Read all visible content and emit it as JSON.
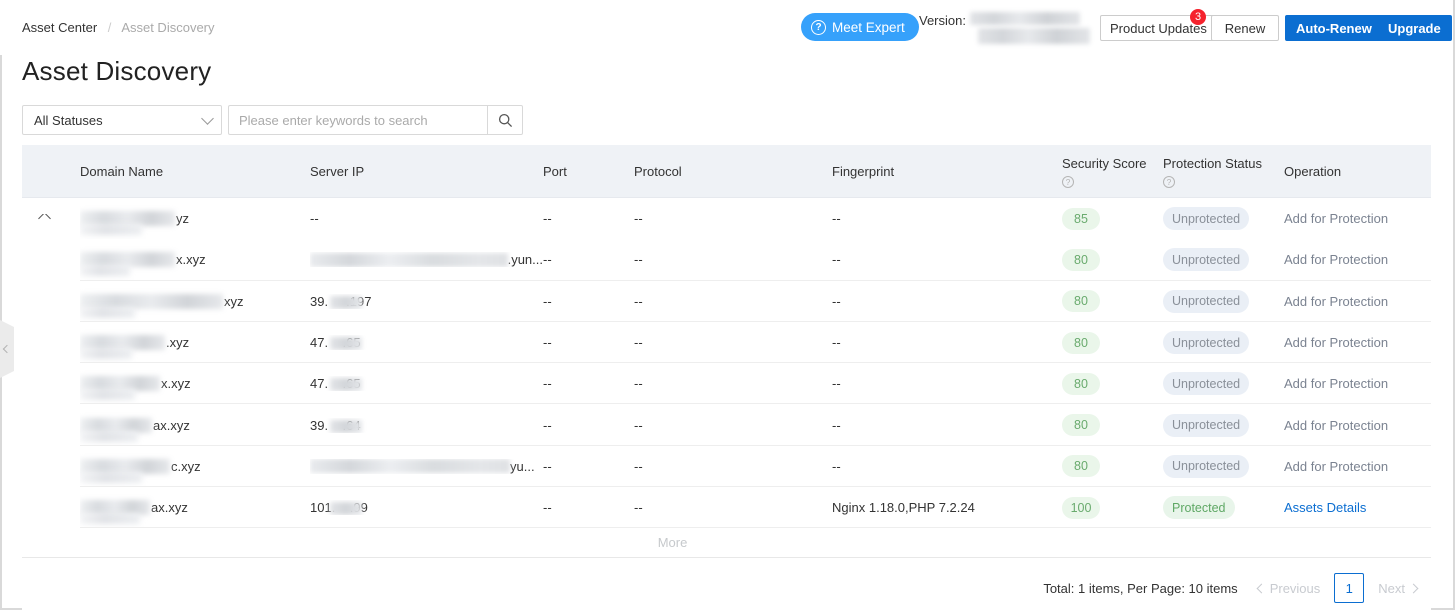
{
  "breadcrumb": {
    "parent": "Asset Center",
    "separator": "/",
    "current": "Asset Discovery"
  },
  "page_title": "Asset Discovery",
  "header": {
    "meet_expert": "Meet Expert",
    "version_label": "Version:",
    "product_updates": "Product Updates",
    "updates_badge": "3",
    "renew": "Renew",
    "auto_renew": "Auto-Renew",
    "upgrade": "Upgrade"
  },
  "filters": {
    "status_selected": "All Statuses",
    "status_options": [
      "All Statuses"
    ],
    "search_placeholder": "Please enter keywords to search",
    "search_value": ""
  },
  "table": {
    "columns": [
      {
        "label": "Domain Name",
        "help": false
      },
      {
        "label": "Server IP",
        "help": false
      },
      {
        "label": "Port",
        "help": false
      },
      {
        "label": "Protocol",
        "help": false
      },
      {
        "label": "Fingerprint",
        "help": false
      },
      {
        "label": "Security Score",
        "help": true
      },
      {
        "label": "Protection Status",
        "help": true
      },
      {
        "label": "Operation",
        "help": false
      }
    ],
    "help_glyph": "?",
    "rows": [
      {
        "domain_suffix": "yz",
        "domain_redact_w": 95,
        "domain_redact2_w": 62,
        "server_ip": "--",
        "ip_redact_w": 0,
        "port": "--",
        "protocol": "--",
        "fingerprint": "--",
        "security_score": "85",
        "protection_status": "Unprotected",
        "operation": "Add for Protection",
        "operation_style": "muted",
        "expandable": true
      },
      {
        "domain_suffix": "x.xyz",
        "domain_redact_w": 95,
        "domain_redact2_w": 50,
        "server_ip": ".yun...",
        "ip_redact_w": 205,
        "port": "--",
        "protocol": "--",
        "fingerprint": "--",
        "security_score": "80",
        "protection_status": "Unprotected",
        "operation": "Add for Protection",
        "operation_style": "muted",
        "expandable": false
      },
      {
        "domain_suffix": "xyz",
        "domain_redact_w": 143,
        "domain_redact2_w": 55,
        "server_ip": "39.     .197",
        "ip_redact_w": 0,
        "port": "--",
        "protocol": "--",
        "fingerprint": "--",
        "security_score": "80",
        "protection_status": "Unprotected",
        "operation": "Add for Protection",
        "operation_style": "muted",
        "expandable": false
      },
      {
        "domain_suffix": ".xyz",
        "domain_redact_w": 85,
        "domain_redact2_w": 52,
        "server_ip": "47.    .65",
        "ip_redact_w": 0,
        "port": "--",
        "protocol": "--",
        "fingerprint": "--",
        "security_score": "80",
        "protection_status": "Unprotected",
        "operation": "Add for Protection",
        "operation_style": "muted",
        "expandable": false
      },
      {
        "domain_suffix": "x.xyz",
        "domain_redact_w": 80,
        "domain_redact2_w": 55,
        "server_ip": "47.    .65",
        "ip_redact_w": 0,
        "port": "--",
        "protocol": "--",
        "fingerprint": "--",
        "security_score": "80",
        "protection_status": "Unprotected",
        "operation": "Add for Protection",
        "operation_style": "muted",
        "expandable": false
      },
      {
        "domain_suffix": "ax.xyz",
        "domain_redact_w": 72,
        "domain_redact2_w": 58,
        "server_ip": "39.    .64",
        "ip_redact_w": 0,
        "port": "--",
        "protocol": "--",
        "fingerprint": "--",
        "security_score": "80",
        "protection_status": "Unprotected",
        "operation": "Add for Protection",
        "operation_style": "muted",
        "expandable": false
      },
      {
        "domain_suffix": "c.xyz",
        "domain_redact_w": 90,
        "domain_redact2_w": 62,
        "server_ip": "yu...",
        "ip_redact_w": 200,
        "port": "--",
        "protocol": "--",
        "fingerprint": "--",
        "security_score": "80",
        "protection_status": "Unprotected",
        "operation": "Add for Protection",
        "operation_style": "muted",
        "expandable": false
      },
      {
        "domain_suffix": "ax.xyz",
        "domain_redact_w": 70,
        "domain_redact2_w": 60,
        "server_ip": "101.    .99",
        "ip_redact_w": 0,
        "port": "--",
        "protocol": "--",
        "fingerprint": "Nginx 1.18.0,PHP 7.2.24",
        "security_score": "100",
        "protection_status": "Protected",
        "operation": "Assets Details",
        "operation_style": "blue",
        "expandable": false
      }
    ],
    "more_label": "More"
  },
  "pagination": {
    "total_text": "Total: 1 items, Per Page: 10 items",
    "previous": "Previous",
    "current_page": "1",
    "next": "Next"
  },
  "colors": {
    "primary": "#0b6ed1",
    "accent_light_blue": "#36a1fb",
    "badge_red": "#f5222d",
    "score_green": "#6aab6e",
    "status_protected": "#5fa865",
    "status_unprotected": "#8a9099",
    "header_bg": "#eff2f6"
  }
}
